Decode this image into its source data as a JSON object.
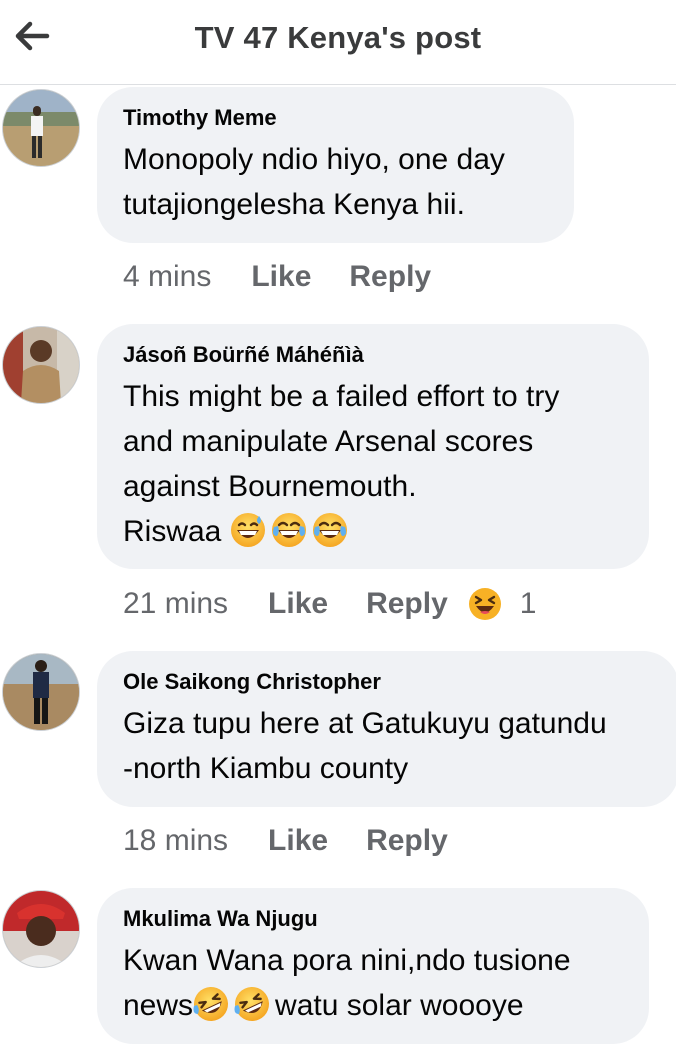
{
  "header": {
    "title": "TV 47 Kenya's post",
    "back_icon": "arrow-left-icon"
  },
  "colors": {
    "bubble": "#f0f2f5",
    "meta_text": "#65676b",
    "title_text": "#3a3b3c",
    "reaction": "#f7b125"
  },
  "comments": [
    {
      "author": "Timothy Meme",
      "lines": [
        "Monopoly ndio hiyo, one day",
        "tutajiongelesha Kenya hii."
      ],
      "time": "4 mins",
      "like": "Like",
      "reply": "Reply"
    },
    {
      "author": "Jásoñ Boürñé Máhéñìà",
      "lines": [
        "This might be a failed effort to try",
        "and manipulate Arsenal scores",
        "against Bournemouth.",
        "Riswaa"
      ],
      "emojis": [
        "grinning-sweat-emoji",
        "tears-of-joy-emoji",
        "tears-of-joy-emoji"
      ],
      "time": "21 mins",
      "like": "Like",
      "reply": "Reply",
      "reaction": {
        "icon": "haha-reaction-icon",
        "count": "1"
      }
    },
    {
      "author": "Ole Saikong Christopher",
      "lines": [
        "Giza tupu here at Gatukuyu gatundu",
        "-north Kiambu county"
      ],
      "time": "18 mins",
      "like": "Like",
      "reply": "Reply"
    },
    {
      "author": "Mkulima Wa Njugu",
      "lines": [
        "Kwan Wana pora nini,ndo tusione",
        "news",
        "watu solar woooye"
      ],
      "emojis": [
        "rolling-laughing-emoji",
        "rolling-laughing-emoji"
      ]
    }
  ]
}
